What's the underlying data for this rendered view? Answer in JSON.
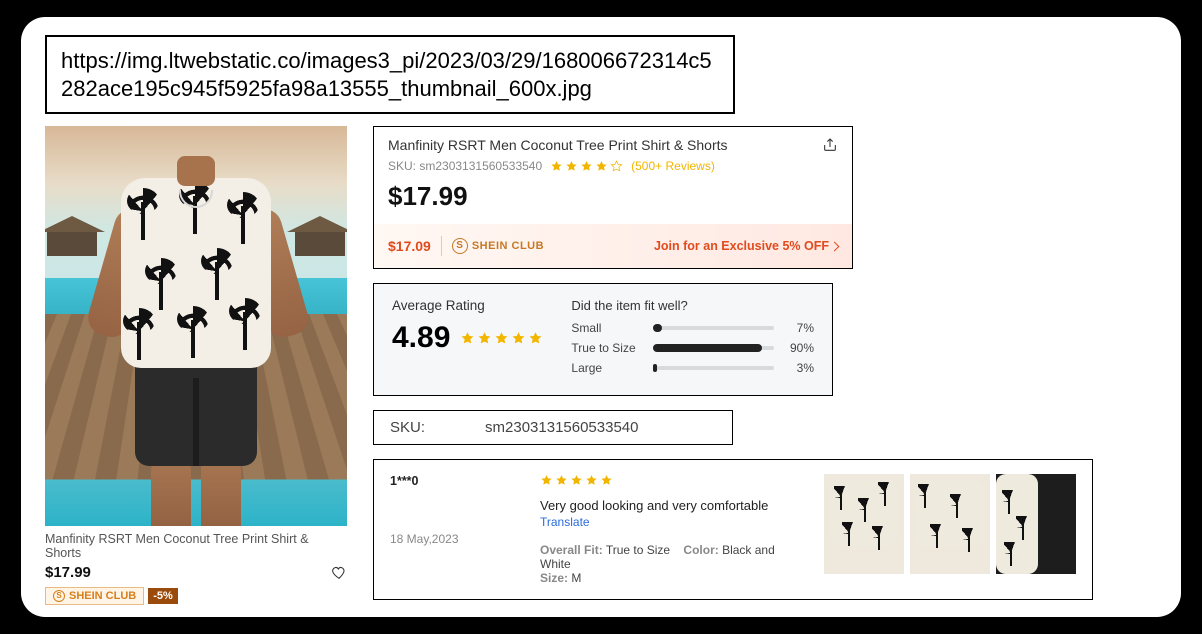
{
  "url": "https://img.ltwebstatic.co/images3_pi/2023/03/29/168006672314c5282ace195c945f5925fa98a13555_thumbnail_600x.jpg",
  "product": {
    "title": "Manfinity RSRT Men Coconut Tree Print Shirt & Shorts",
    "sku_prefix": "SKU:",
    "sku": "sm2303131560533540",
    "price": "$17.99",
    "reviews_label": "(500+ Reviews)"
  },
  "club": {
    "badge": "SHEIN CLUB",
    "discount_badge": "-5%",
    "club_price": "$17.09",
    "cta": "Join for an Exclusive 5% OFF"
  },
  "left_card": {
    "title": "Manfinity RSRT Men Coconut Tree Print Shirt & Shorts",
    "price": "$17.99"
  },
  "rating": {
    "avg_label": "Average Rating",
    "avg_value": "4.89",
    "fit_question": "Did the item fit well?",
    "bars": [
      {
        "label": "Small",
        "pct": "7%",
        "w": 7
      },
      {
        "label": "True to Size",
        "pct": "90%",
        "w": 90
      },
      {
        "label": "Large",
        "pct": "3%",
        "w": 3
      }
    ]
  },
  "sku_box": {
    "label": "SKU:",
    "value": "sm2303131560533540"
  },
  "review": {
    "user": "1***0",
    "date": "18 May,2023",
    "text": "Very good looking and very comfortable",
    "translate": "Translate",
    "meta": {
      "fit_label": "Overall Fit:",
      "fit_value": "True to Size",
      "color_label": "Color:",
      "color_value": "Black and White",
      "size_label": "Size:",
      "size_value": "M"
    }
  }
}
